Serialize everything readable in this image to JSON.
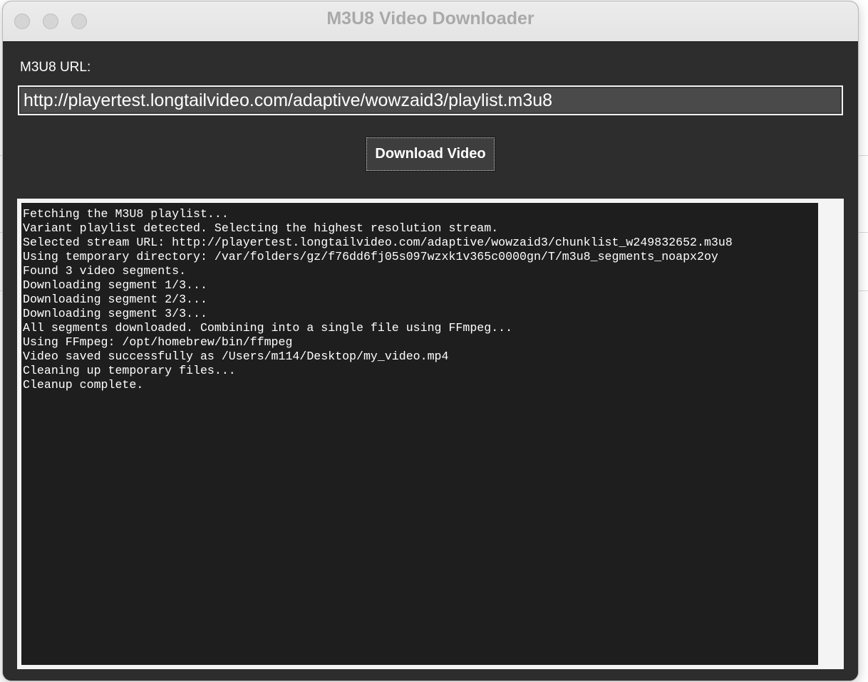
{
  "window": {
    "title": "M3U8 Video Downloader"
  },
  "form": {
    "url_label": "M3U8 URL:",
    "url_value": "http://playertest.longtailvideo.com/adaptive/wowzaid3/playlist.m3u8",
    "download_button_label": "Download Video"
  },
  "log": {
    "lines": [
      "Fetching the M3U8 playlist...",
      "Variant playlist detected. Selecting the highest resolution stream.",
      "Selected stream URL: http://playertest.longtailvideo.com/adaptive/wowzaid3/chunklist_w249832652.m3u8",
      "Using temporary directory: /var/folders/gz/f76dd6fj05s097wzxk1v365c0000gn/T/m3u8_segments_noapx2oy",
      "Found 3 video segments.",
      "Downloading segment 1/3...",
      "Downloading segment 2/3...",
      "Downloading segment 3/3...",
      "All segments downloaded. Combining into a single file using FFmpeg...",
      "Using FFmpeg: /opt/homebrew/bin/ffmpeg",
      "Video saved successfully as /Users/m114/Desktop/my_video.mp4",
      "Cleaning up temporary files...",
      "Cleanup complete."
    ]
  },
  "colors": {
    "window_bg": "#2d2d2d",
    "log_bg": "#1e1e1e",
    "input_bg": "#4a4a4a",
    "button_bg": "#3e3e3e",
    "title_text": "#a9a9a9"
  }
}
